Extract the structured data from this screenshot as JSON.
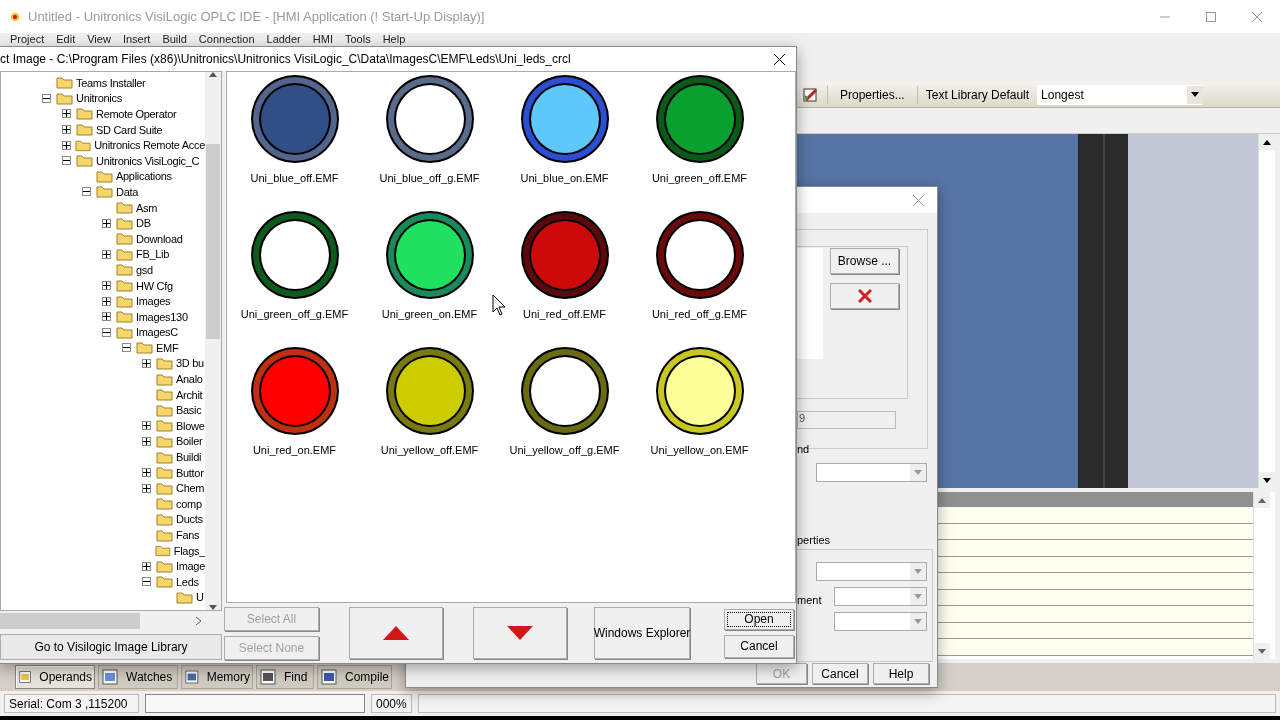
{
  "main_window": {
    "title": "Untitled - Unitronics VisiLogic OPLC IDE - [HMI Application (! Start-Up Display)]",
    "menu": [
      "Project",
      "Edit",
      "View",
      "Insert",
      "Build",
      "Connection",
      "Ladder",
      "HMI",
      "Tools",
      "Help"
    ],
    "toolbar": {
      "properties_button": "Properties...",
      "text_library_label": "Text Library Default",
      "text_library_value": "Longest"
    },
    "bottom_tabs": [
      {
        "label": "Operands",
        "selected": true
      },
      {
        "label": "Watches",
        "selected": false
      },
      {
        "label": "Memory",
        "selected": false
      },
      {
        "label": "Find",
        "selected": false
      },
      {
        "label": "Compile",
        "selected": false
      }
    ],
    "status_bar": {
      "connection": "Serial: Com 3 ,115200",
      "progress": "000%",
      "level": 0
    }
  },
  "select_image_dialog": {
    "title": "ct Image - C:\\Program Files (x86)\\Unitronics\\Unitronics VisiLogic_C\\Data\\ImagesC\\EMF\\Leds\\Uni_leds_crcl",
    "folder_tree": [
      {
        "label": "Teams Installer",
        "kind": "leaf"
      },
      {
        "label": "Unitronics",
        "kind": "branch",
        "expanded": true,
        "children": [
          {
            "label": "Remote Operator",
            "kind": "branch",
            "expanded": false
          },
          {
            "label": "SD Card Suite",
            "kind": "branch",
            "expanded": false
          },
          {
            "label": "Unitronics Remote Acce",
            "kind": "branch",
            "expanded": false
          },
          {
            "label": "Unitronics VisiLogic_C",
            "kind": "branch",
            "expanded": true,
            "children": [
              {
                "label": "Applications",
                "kind": "leaf"
              },
              {
                "label": "Data",
                "kind": "branch",
                "expanded": true,
                "children": [
                  {
                    "label": "Asm",
                    "kind": "leaf"
                  },
                  {
                    "label": "DB",
                    "kind": "branch",
                    "expanded": false
                  },
                  {
                    "label": "Download",
                    "kind": "leaf"
                  },
                  {
                    "label": "FB_Lib",
                    "kind": "branch",
                    "expanded": false
                  },
                  {
                    "label": "gsd",
                    "kind": "leaf"
                  },
                  {
                    "label": "HW Cfg",
                    "kind": "branch",
                    "expanded": false
                  },
                  {
                    "label": "Images",
                    "kind": "branch",
                    "expanded": false
                  },
                  {
                    "label": "Images130",
                    "kind": "branch",
                    "expanded": false
                  },
                  {
                    "label": "ImagesC",
                    "kind": "branch",
                    "expanded": true,
                    "children": [
                      {
                        "label": "EMF",
                        "kind": "branch",
                        "expanded": true,
                        "children": [
                          {
                            "label": "3D bu",
                            "kind": "branch",
                            "expanded": false
                          },
                          {
                            "label": "Analo",
                            "kind": "leaf"
                          },
                          {
                            "label": "Archit",
                            "kind": "leaf"
                          },
                          {
                            "label": "Basic",
                            "kind": "leaf"
                          },
                          {
                            "label": "Blowe",
                            "kind": "branch",
                            "expanded": false
                          },
                          {
                            "label": "Boiler",
                            "kind": "branch",
                            "expanded": false
                          },
                          {
                            "label": "Buildi",
                            "kind": "leaf"
                          },
                          {
                            "label": "Buttor",
                            "kind": "branch",
                            "expanded": false
                          },
                          {
                            "label": "Chem",
                            "kind": "branch",
                            "expanded": false
                          },
                          {
                            "label": "comp",
                            "kind": "leaf"
                          },
                          {
                            "label": "Ducts",
                            "kind": "leaf"
                          },
                          {
                            "label": "Fans",
                            "kind": "leaf"
                          },
                          {
                            "label": "Flags_",
                            "kind": "leaf"
                          },
                          {
                            "label": "Image",
                            "kind": "branch",
                            "expanded": false
                          },
                          {
                            "label": "Leds",
                            "kind": "branch",
                            "expanded": true,
                            "children": [
                              {
                                "label": "U",
                                "kind": "leaf"
                              }
                            ]
                          }
                        ]
                      }
                    ]
                  }
                ]
              }
            ]
          }
        ]
      }
    ],
    "images": [
      {
        "name": "Uni_blue_off.EMF",
        "ring": {
          "color": "#52658f"
        },
        "color": "#2f4f86"
      },
      {
        "name": "Uni_blue_off_g.EMF",
        "ring": {
          "color": "#5a6a8a"
        },
        "color": "#ffffff"
      },
      {
        "name": "Uni_blue_on.EMF",
        "ring": {
          "color": "#2b4fd0"
        },
        "color": "#5ec8fa"
      },
      {
        "name": "Uni_green_off.EMF",
        "ring": {
          "color": "#0b5a1a"
        },
        "color": "#0aa030"
      },
      {
        "name": "Uni_green_off_g.EMF",
        "ring": {
          "color": "#0d5a1c"
        },
        "color": "#ffffff"
      },
      {
        "name": "Uni_green_on.EMF",
        "ring": {
          "color": "#1a8a5a"
        },
        "color": "#20e060"
      },
      {
        "name": "Uni_red_off.EMF",
        "ring": {
          "color": "#5a0a0a"
        },
        "color": "#cc0a0a"
      },
      {
        "name": "Uni_red_off_g.EMF",
        "ring": {
          "color": "#6a0a0a"
        },
        "color": "#ffffff"
      },
      {
        "name": "Uni_red_on.EMF",
        "ring": {
          "color": "#c03010"
        },
        "color": "#ff0000"
      },
      {
        "name": "Uni_yellow_off.EMF",
        "ring": {
          "color": "#7a7a10"
        },
        "color": "#cccc00"
      },
      {
        "name": "Uni_yellow_off_g.EMF",
        "ring": {
          "color": "#6a6a12"
        },
        "color": "#ffffff"
      },
      {
        "name": "Uni_yellow_on.EMF",
        "ring": {
          "color": "#c8c820"
        },
        "color": "#ffff99"
      }
    ],
    "library_button": "Go to Visilogic Image Library",
    "select_buttons": [
      {
        "label": "Select All",
        "disabled": true
      },
      {
        "label": "Select None",
        "disabled": true
      }
    ],
    "explorer_button": "Windows Explorer",
    "open_button": "Open",
    "cancel_button": "Cancel"
  },
  "properties_dialog": {
    "browse_button": "Browse ...",
    "field_value": "9",
    "label_1": "nd",
    "group_label": "perties",
    "label_2": "ment",
    "buttons": [
      {
        "label": "OK",
        "disabled": true
      },
      {
        "label": "Cancel",
        "disabled": false
      },
      {
        "label": "Help",
        "disabled": false
      }
    ]
  }
}
